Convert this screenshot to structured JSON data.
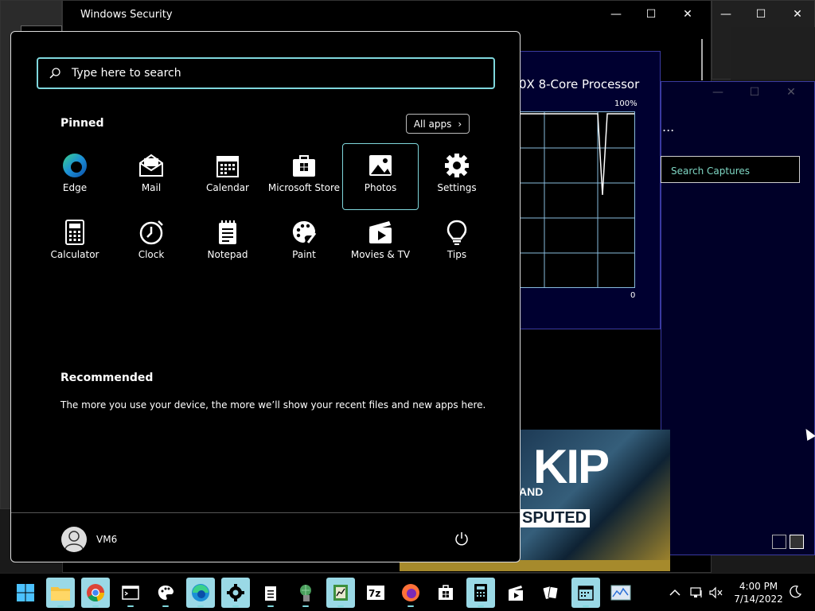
{
  "background": {
    "security_window_title": "Windows Security",
    "cpu_title": "0X 8-Core Processor",
    "cpu_max": "100%",
    "cpu_min": "0",
    "capture_search": "Search Captures",
    "capture_more": "...",
    "thumbnail_text": [
      "KIP",
      "AND",
      "SPUTED"
    ]
  },
  "start_menu": {
    "search_placeholder": "Type here to search",
    "pinned_label": "Pinned",
    "all_apps_label": "All apps",
    "pinned_apps": [
      {
        "name": "Edge",
        "icon": "edge-icon"
      },
      {
        "name": "Mail",
        "icon": "mail-icon"
      },
      {
        "name": "Calendar",
        "icon": "calendar-icon"
      },
      {
        "name": "Microsoft Store",
        "icon": "store-icon"
      },
      {
        "name": "Photos",
        "icon": "photos-icon",
        "selected": true
      },
      {
        "name": "Settings",
        "icon": "gear-icon"
      },
      {
        "name": "Calculator",
        "icon": "calculator-icon"
      },
      {
        "name": "Clock",
        "icon": "clock-icon"
      },
      {
        "name": "Notepad",
        "icon": "notepad-icon"
      },
      {
        "name": "Paint",
        "icon": "palette-icon"
      },
      {
        "name": "Movies & TV",
        "icon": "movies-icon"
      },
      {
        "name": "Tips",
        "icon": "lightbulb-icon"
      }
    ],
    "recommended_label": "Recommended",
    "recommended_text": "The more you use your device, the more we’ll show your recent files and new apps here.",
    "user_name": "VM6"
  },
  "taskbar": {
    "apps": [
      "start",
      "file-explorer",
      "chrome",
      "terminal",
      "paint",
      "edge",
      "settings",
      "notepad",
      "network-tool",
      "task-app",
      "7zip",
      "firefox",
      "store",
      "calculator",
      "movies",
      "solitaire",
      "calendar",
      "monitor"
    ],
    "time": "4:00 PM",
    "date": "7/14/2022"
  }
}
